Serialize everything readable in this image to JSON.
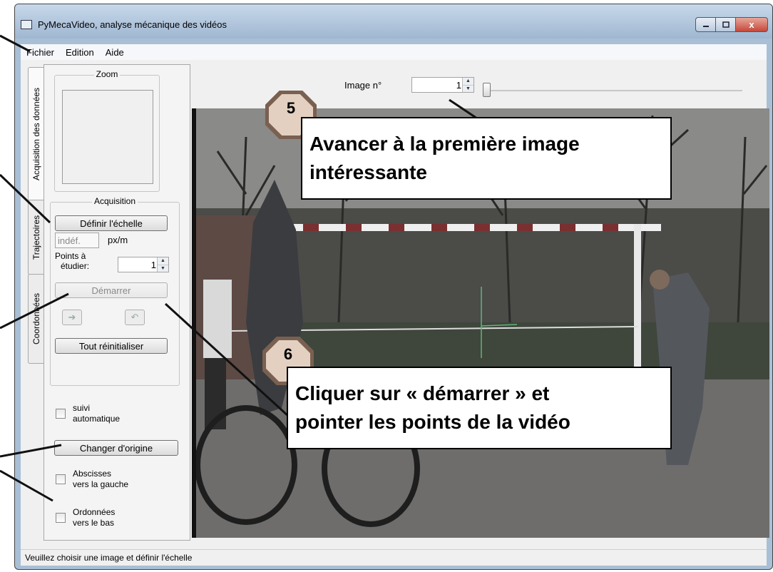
{
  "window": {
    "title": "PyMecaVideo, analyse mécanique des vidéos",
    "close_label": "x"
  },
  "menu": [
    "Fichier",
    "Edition",
    "Aide"
  ],
  "tabs": [
    "Acquisition des données",
    "Trajectoires",
    "Coordonnées"
  ],
  "zoom": {
    "title": "Zoom"
  },
  "acquisition": {
    "title": "Acquisition",
    "define_scale": "Définir l'échelle",
    "scale_value": "indéf.",
    "scale_unit": "px/m",
    "points_label_1": "Points à",
    "points_label_2": "étudier:",
    "points_value": "1",
    "start": "Démarrer",
    "reset": "Tout réinitialiser"
  },
  "options": {
    "auto_follow_1": "suivi",
    "auto_follow_2": "automatique",
    "change_origin": "Changer d'origine",
    "abscissa_1": "Abscisses",
    "abscissa_2": "vers la gauche",
    "ordinate_1": "Ordonnées",
    "ordinate_2": "vers le bas"
  },
  "image_nav": {
    "label": "Image n°",
    "value": "1"
  },
  "status": "Veuillez choisir une image et définir l'échelle",
  "callouts": [
    {
      "num": "5",
      "line1": "Avancer à la première image",
      "line2": "intéressante"
    },
    {
      "num": "6",
      "line1": "Cliquer sur « démarrer » et",
      "line2": "pointer les points de la vidéo"
    }
  ],
  "colors": {
    "title_bar": "#a9bfd6",
    "close_button": "#c5473a",
    "badge_fill": "#e3d0c0",
    "badge_border": "#7a6050"
  }
}
